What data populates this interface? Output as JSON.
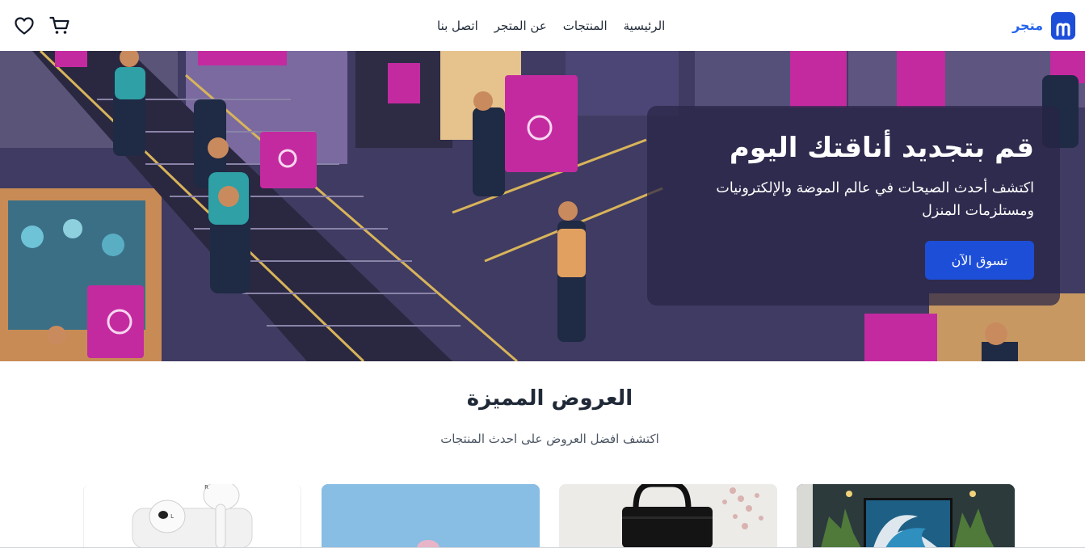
{
  "brand": {
    "name": "متجر",
    "logo_icon": "shopping-bag-icon",
    "accent": "#2563eb"
  },
  "nav": {
    "home": "الرئيسية",
    "products": "المنتجات",
    "about": "عن المتجر",
    "contact": "اتصل بنا"
  },
  "header_icons": {
    "cart": "cart-icon",
    "wishlist": "heart-icon"
  },
  "hero": {
    "title": "قم بتجديد أناقتك اليوم",
    "subtitle": "اكتشف أحدث الصيحات في عالم الموضة والإلكترونيات ومستلزمات المنزل",
    "cta_label": "تسوق الآن",
    "cta_color": "#1d4ed8"
  },
  "featured": {
    "title": "العروض المميزة",
    "subtitle": "اكتشف افضل العروض على احدث المنتجات"
  }
}
